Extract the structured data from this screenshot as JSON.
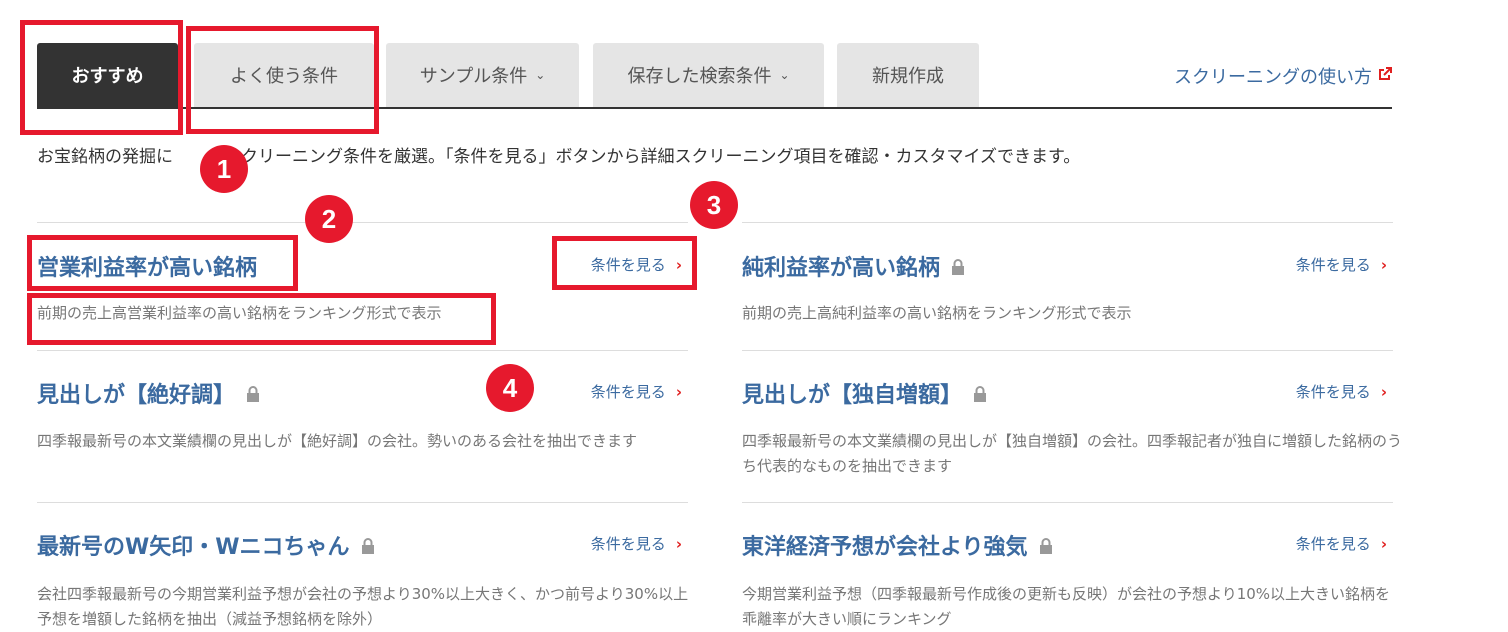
{
  "tabs": [
    {
      "label": "おすすめ",
      "active": true,
      "has_dropdown": false
    },
    {
      "label": "よく使う条件",
      "active": false,
      "has_dropdown": false
    },
    {
      "label": "サンプル条件",
      "active": false,
      "has_dropdown": true
    },
    {
      "label": "保存した検索条件",
      "active": false,
      "has_dropdown": true
    },
    {
      "label": "新規作成",
      "active": false,
      "has_dropdown": false
    }
  ],
  "howto_link": {
    "label": "スクリーニングの使い方",
    "icon": "external-link-icon"
  },
  "intro_text": "お宝銘柄の発掘に　　　スクリーニング条件を厳選。「条件を見る」ボタンから詳細スクリーニング項目を確認・カスタマイズできます。",
  "cards": [
    {
      "title": "営業利益率が高い銘柄",
      "locked": false,
      "link": "条件を見る",
      "desc": "前期の売上高営業利益率の高い銘柄をランキング形式で表示"
    },
    {
      "title": "純利益率が高い銘柄",
      "locked": true,
      "link": "条件を見る",
      "desc": "前期の売上高純利益率の高い銘柄をランキング形式で表示"
    },
    {
      "title": "見出しが【絶好調】",
      "locked": true,
      "link": "条件を見る",
      "desc": "四季報最新号の本文業績欄の見出しが【絶好調】の会社。勢いのある会社を抽出できます"
    },
    {
      "title": "見出しが【独自増額】",
      "locked": true,
      "link": "条件を見る",
      "desc": "四季報最新号の本文業績欄の見出しが【独自増額】の会社。四季報記者が独自に増額した銘柄のうち代表的なものを抽出できます"
    },
    {
      "title": "最新号のW矢印・Wニコちゃん",
      "locked": true,
      "link": "条件を見る",
      "desc": "会社四季報最新号の今期営業利益予想が会社の予想より30%以上大きく、かつ前号より30%以上予想を増額した銘柄を抽出（減益予想銘柄を除外）"
    },
    {
      "title": "東洋経済予想が会社より強気",
      "locked": true,
      "link": "条件を見る",
      "desc": "今期営業利益予想（四季報最新号作成後の更新も反映）が会社の予想より10%以上大きい銘柄を乖離率が大きい順にランキング"
    }
  ],
  "annotations": [
    "1",
    "2",
    "3",
    "4"
  ],
  "colors": {
    "accent_red": "#e6192d",
    "link_blue": "#3b6aa0",
    "tab_active": "#333333",
    "tab_inactive": "#e5e5e5"
  }
}
